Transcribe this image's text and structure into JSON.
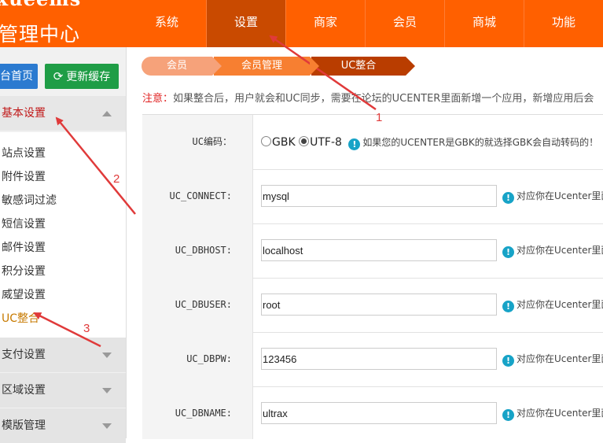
{
  "header": {
    "logo_top": "xueems",
    "logo_title": "管理中心",
    "nav": [
      "系统",
      "设置",
      "商家",
      "会员",
      "商城",
      "功能"
    ],
    "active_nav": 1,
    "colors": {
      "bar": "#ff6000",
      "active": "#c94a00"
    }
  },
  "sidebar": {
    "home_button": "台首页",
    "refresh_button": "更新缓存",
    "refresh_icon": "refresh-icon",
    "groups": [
      {
        "label": "基本设置",
        "expanded": true
      },
      {
        "label": "支付设置",
        "expanded": false
      },
      {
        "label": "区域设置",
        "expanded": false
      },
      {
        "label": "模版管理",
        "expanded": false
      }
    ],
    "items": [
      "站点设置",
      "附件设置",
      "敏感词过滤",
      "短信设置",
      "邮件设置",
      "积分设置",
      "威望设置",
      "UC整合"
    ],
    "active_item": 7
  },
  "breadcrumb": [
    "会员",
    "会员管理",
    "UC整合"
  ],
  "notice": {
    "label": "注意：",
    "text": "如果整合后，用户就会和UC同步，需要在论坛的UCENTER里面新增一个应用，新增应用后会"
  },
  "form": {
    "encoding": {
      "label": "UC编码：",
      "options": [
        "GBK",
        "UTF-8"
      ],
      "selected": "UTF-8",
      "hint": "如果您的UCENTER是GBK的就选择GBK会自动转码的！"
    },
    "rows": [
      {
        "label": "UC_CONNECT:",
        "value": "mysql",
        "hint": "对应你在Ucenter里面"
      },
      {
        "label": "UC_DBHOST:",
        "value": "localhost",
        "hint": "对应你在Ucenter里面"
      },
      {
        "label": "UC_DBUSER:",
        "value": "root",
        "hint": "对应你在Ucenter里面"
      },
      {
        "label": "UC_DBPW:",
        "value": "123456",
        "hint": "对应你在Ucenter里面"
      },
      {
        "label": "UC_DBNAME:",
        "value": "ultrax",
        "hint": "对应你在Ucenter里面"
      }
    ]
  },
  "annotations": [
    "1",
    "2",
    "3"
  ]
}
